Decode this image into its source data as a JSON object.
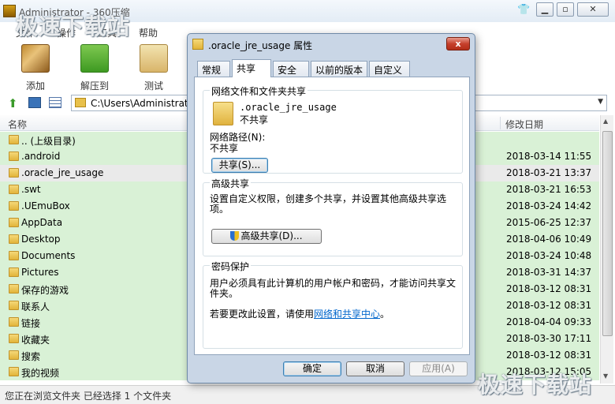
{
  "main": {
    "title": "Administrator - 360压缩",
    "menu": [
      "文件",
      "操作",
      "工具",
      "帮助"
    ],
    "toolbar": [
      {
        "label": "添加",
        "icon": "add-archive-icon"
      },
      {
        "label": "解压到",
        "icon": "extract-icon"
      },
      {
        "label": "测试",
        "icon": "test-icon"
      }
    ],
    "address": "C:\\Users\\Administrator",
    "columns": {
      "name": "名称",
      "date": "修改日期"
    },
    "rows": [
      {
        "name": ".. (上级目录)",
        "date": ""
      },
      {
        "name": ".android",
        "date": "2018-03-14 11:55"
      },
      {
        "name": ".oracle_jre_usage",
        "date": "2018-03-21 13:37"
      },
      {
        "name": ".swt",
        "date": "2018-03-21 16:53"
      },
      {
        "name": ".UEmuBox",
        "date": "2018-03-24 14:42"
      },
      {
        "name": "AppData",
        "date": "2015-06-25 12:37"
      },
      {
        "name": "Desktop",
        "date": "2018-04-06 10:49"
      },
      {
        "name": "Documents",
        "date": "2018-03-24 10:48"
      },
      {
        "name": "Pictures",
        "date": "2018-03-31 14:37"
      },
      {
        "name": "保存的游戏",
        "date": "2018-03-12 08:31"
      },
      {
        "name": "联系人",
        "date": "2018-03-12 08:31"
      },
      {
        "name": "链接",
        "date": "2018-04-04 09:33"
      },
      {
        "name": "收藏夹",
        "date": "2018-03-30 17:11"
      },
      {
        "name": "搜索",
        "date": "2018-03-12 08:31"
      },
      {
        "name": "我的视频",
        "date": "2018-03-12 15:05"
      }
    ],
    "selected_row": 2,
    "status": "您正在浏览文件夹 已经选择 1 个文件夹",
    "watermark": "极速下载站"
  },
  "dialog": {
    "title": ".oracle_jre_usage 属性",
    "close": "x",
    "tabs": [
      "常规",
      "共享",
      "安全",
      "以前的版本",
      "自定义"
    ],
    "active_tab": 1,
    "share_group": {
      "title": "网络文件和文件夹共享",
      "folder_name": ".oracle_jre_usage",
      "folder_state": "不共享",
      "path_label": "网络路径(N):",
      "path_value": "不共享",
      "button": "共享(S)..."
    },
    "advanced_group": {
      "title": "高级共享",
      "desc": "设置自定义权限，创建多个共享，并设置其他高级共享选项。",
      "button": "高级共享(D)..."
    },
    "password_group": {
      "title": "密码保护",
      "desc": "用户必须具有此计算机的用户帐户和密码，才能访问共享文件夹。",
      "change_prefix": "若要更改此设置，请使用",
      "change_link": "网络和共享中心",
      "change_suffix": "。"
    },
    "buttons": {
      "ok": "确定",
      "cancel": "取消",
      "apply": "应用(A)"
    }
  }
}
